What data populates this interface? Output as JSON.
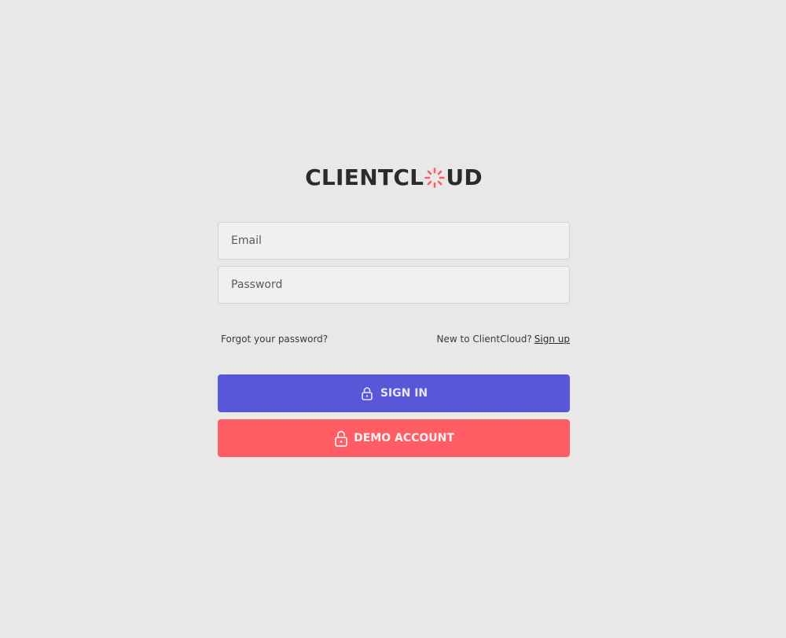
{
  "brand": {
    "logo_prefix": "CLIENTCL",
    "logo_suffix": "UD",
    "logo_mark_icon": "spinner-burst-icon",
    "text_color": "#2b2b2b",
    "accent_color": "#ff5c64"
  },
  "form": {
    "email_placeholder": "Email",
    "email_value": "",
    "password_placeholder": "Password",
    "password_value": ""
  },
  "links": {
    "forgot_password": "Forgot your password?",
    "new_user_prompt": "New to ClientCloud?",
    "signup": "Sign up"
  },
  "buttons": {
    "sign_in": {
      "label": "SIGN IN",
      "icon": "lock-icon",
      "color": "#5757d7"
    },
    "demo": {
      "label": "DEMO ACCOUNT",
      "icon": "unlock-icon",
      "color": "#ff5c64"
    }
  },
  "page": {
    "background": "#e8e8e8"
  }
}
